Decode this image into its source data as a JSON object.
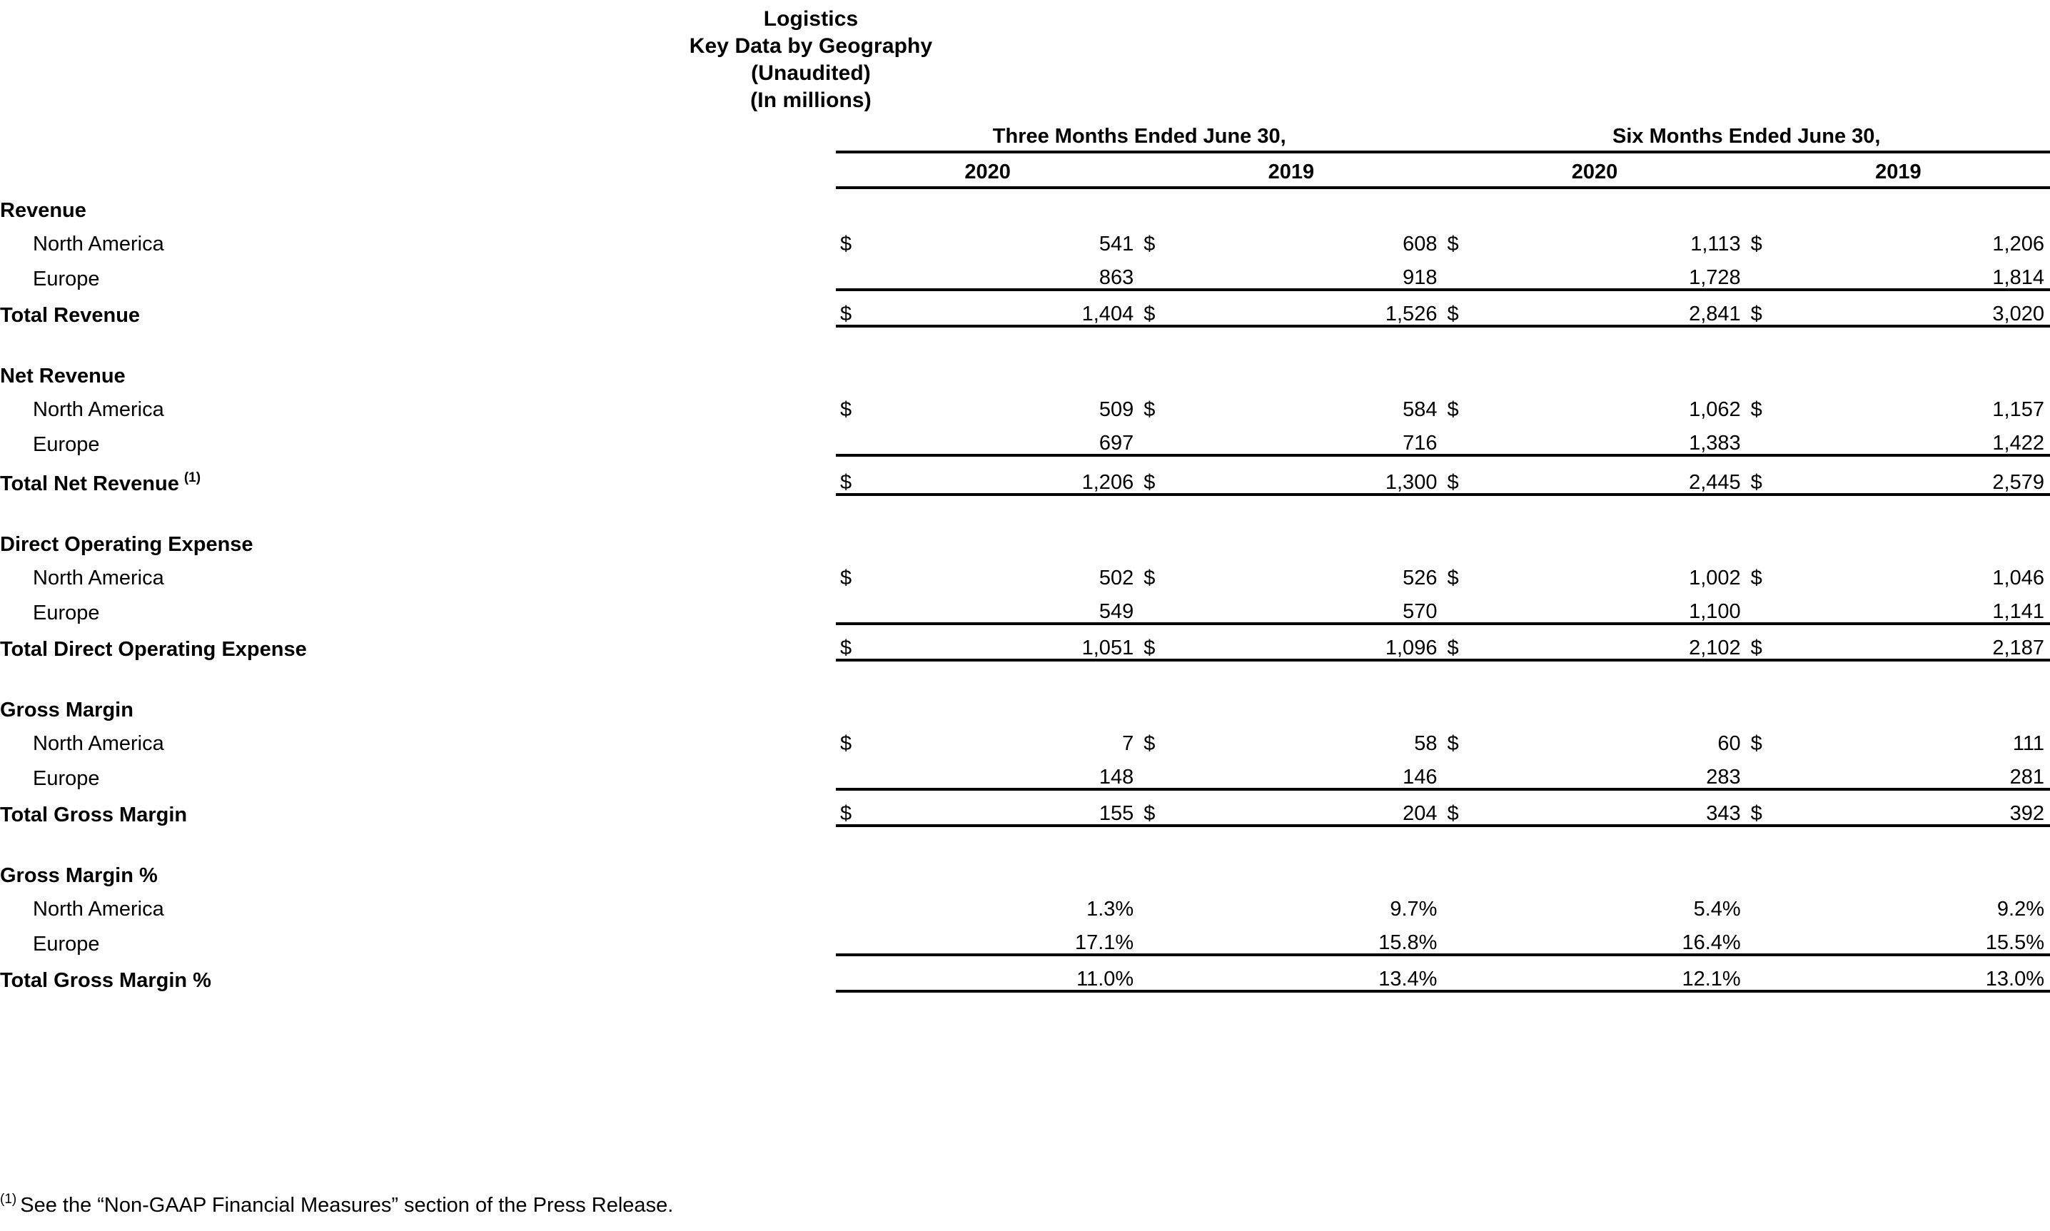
{
  "title": {
    "line1": "Logistics",
    "line2": "Key Data by Geography",
    "line3": "(Unaudited)",
    "line4": "(In millions)"
  },
  "header": {
    "group_three_months": "Three Months Ended June 30,",
    "group_six_months": "Six Months Ended June 30,",
    "years": [
      "2020",
      "2019",
      "2020",
      "2019"
    ]
  },
  "currency_symbol": "$",
  "sections": [
    {
      "id": "revenue",
      "heading": "Revenue",
      "rows": [
        {
          "label": "North America",
          "currency": true,
          "values": [
            "541",
            "608",
            "1,113",
            "1,206"
          ]
        },
        {
          "label": "Europe",
          "currency": false,
          "values": [
            "863",
            "918",
            "1,728",
            "1,814"
          ]
        }
      ],
      "total": {
        "label": "Total Revenue",
        "footnote": "",
        "currency": true,
        "values": [
          "1,404",
          "1,526",
          "2,841",
          "3,020"
        ]
      }
    },
    {
      "id": "net-revenue",
      "heading": "Net Revenue",
      "rows": [
        {
          "label": "North America",
          "currency": true,
          "values": [
            "509",
            "584",
            "1,062",
            "1,157"
          ]
        },
        {
          "label": "Europe",
          "currency": false,
          "values": [
            "697",
            "716",
            "1,383",
            "1,422"
          ]
        }
      ],
      "total": {
        "label": "Total Net Revenue",
        "footnote": "(1)",
        "currency": true,
        "values": [
          "1,206",
          "1,300",
          "2,445",
          "2,579"
        ]
      }
    },
    {
      "id": "direct-operating-expense",
      "heading": "Direct Operating Expense",
      "rows": [
        {
          "label": "North America",
          "currency": true,
          "values": [
            "502",
            "526",
            "1,002",
            "1,046"
          ]
        },
        {
          "label": "Europe",
          "currency": false,
          "values": [
            "549",
            "570",
            "1,100",
            "1,141"
          ]
        }
      ],
      "total": {
        "label": "Total Direct Operating Expense",
        "footnote": "",
        "currency": true,
        "values": [
          "1,051",
          "1,096",
          "2,102",
          "2,187"
        ]
      }
    },
    {
      "id": "gross-margin",
      "heading": "Gross Margin",
      "rows": [
        {
          "label": "North America",
          "currency": true,
          "values": [
            "7",
            "58",
            "60",
            "111"
          ]
        },
        {
          "label": "Europe",
          "currency": false,
          "values": [
            "148",
            "146",
            "283",
            "281"
          ]
        }
      ],
      "total": {
        "label": "Total Gross Margin",
        "footnote": "",
        "currency": true,
        "values": [
          "155",
          "204",
          "343",
          "392"
        ]
      }
    },
    {
      "id": "gross-margin-pct",
      "heading": "Gross Margin %",
      "rows": [
        {
          "label": "North America",
          "currency": false,
          "values": [
            "1.3%",
            "9.7%",
            "5.4%",
            "9.2%"
          ]
        },
        {
          "label": "Europe",
          "currency": false,
          "values": [
            "17.1%",
            "15.8%",
            "16.4%",
            "15.5%"
          ]
        }
      ],
      "total": {
        "label": "Total Gross Margin %",
        "footnote": "",
        "currency": false,
        "values": [
          "11.0%",
          "13.4%",
          "12.1%",
          "13.0%"
        ]
      }
    }
  ],
  "footnote": {
    "marker": "(1)",
    "text": "See the “Non-GAAP Financial Measures” section of the Press Release."
  }
}
